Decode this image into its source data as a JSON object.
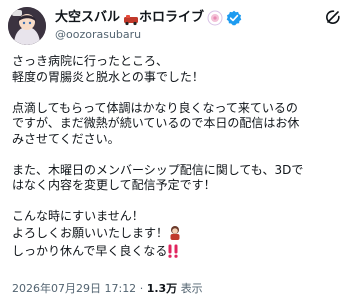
{
  "post": {
    "author": {
      "display_name": "大空スバル",
      "display_name_suffix": "ホロライブ",
      "handle": "@oozorasubaru"
    },
    "lines": {
      "p1_l1": "さっき病院に行ったところ、",
      "p1_l2": "軽度の胃腸炎と脱水との事でした！",
      "p2_l1": "点滴してもらって体調はかなり良くなって来ているの",
      "p2_l2": "ですが、まだ微熱が続いているので本日の配信はお休",
      "p2_l3": "みさせてください。",
      "p3_l1": "また、木曜日のメンバーシップ配信に関しても、3Dで",
      "p3_l2": "はなく内容を変更して配信予定です！",
      "p4_l1": "こんな時にすいません！",
      "p4_l2": "よろしくお願いいたします！",
      "p4_l3": "しっかり休んで早く良くなる"
    },
    "timestamp": "2026年07月29日 17:12",
    "separator": "·",
    "views_count": "1.3万",
    "views_label": "表示"
  },
  "icons": {
    "avatar": "user-avatar",
    "name_emoji_1": "duck-emoji",
    "name_emoji_2": "flower-emoji",
    "verified": "verified-badge-icon",
    "grok": "grok-icon",
    "inline_1": "bowing-girl-emoji",
    "inline_2": "double-exclamation-emoji"
  },
  "colors": {
    "verified": "#1d9bf0",
    "text": "#0f1419",
    "secondary": "#536471"
  }
}
